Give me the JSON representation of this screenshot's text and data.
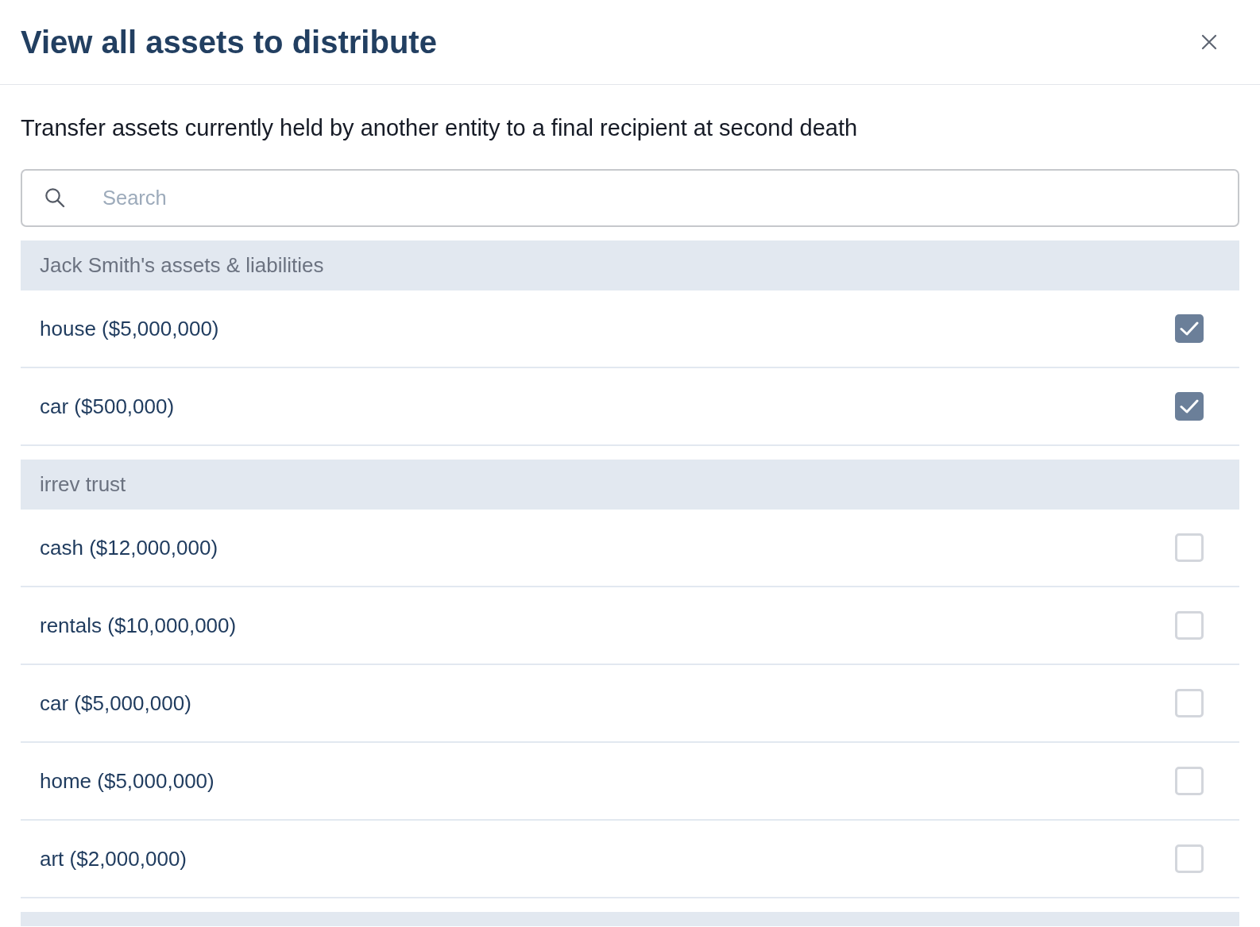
{
  "dialog": {
    "title": "View all assets to distribute",
    "description": "Transfer assets currently held by another entity to a final recipient at second death"
  },
  "search": {
    "placeholder": "Search"
  },
  "groups": [
    {
      "title": "Jack Smith's assets & liabilities",
      "items": [
        {
          "label": "house ($5,000,000)",
          "checked": true
        },
        {
          "label": "car ($500,000)",
          "checked": true
        }
      ]
    },
    {
      "title": "irrev trust",
      "items": [
        {
          "label": "cash ($12,000,000)",
          "checked": false
        },
        {
          "label": "rentals ($10,000,000)",
          "checked": false
        },
        {
          "label": "car ($5,000,000)",
          "checked": false
        },
        {
          "label": "home ($5,000,000)",
          "checked": false
        },
        {
          "label": "art ($2,000,000)",
          "checked": false
        }
      ]
    }
  ]
}
